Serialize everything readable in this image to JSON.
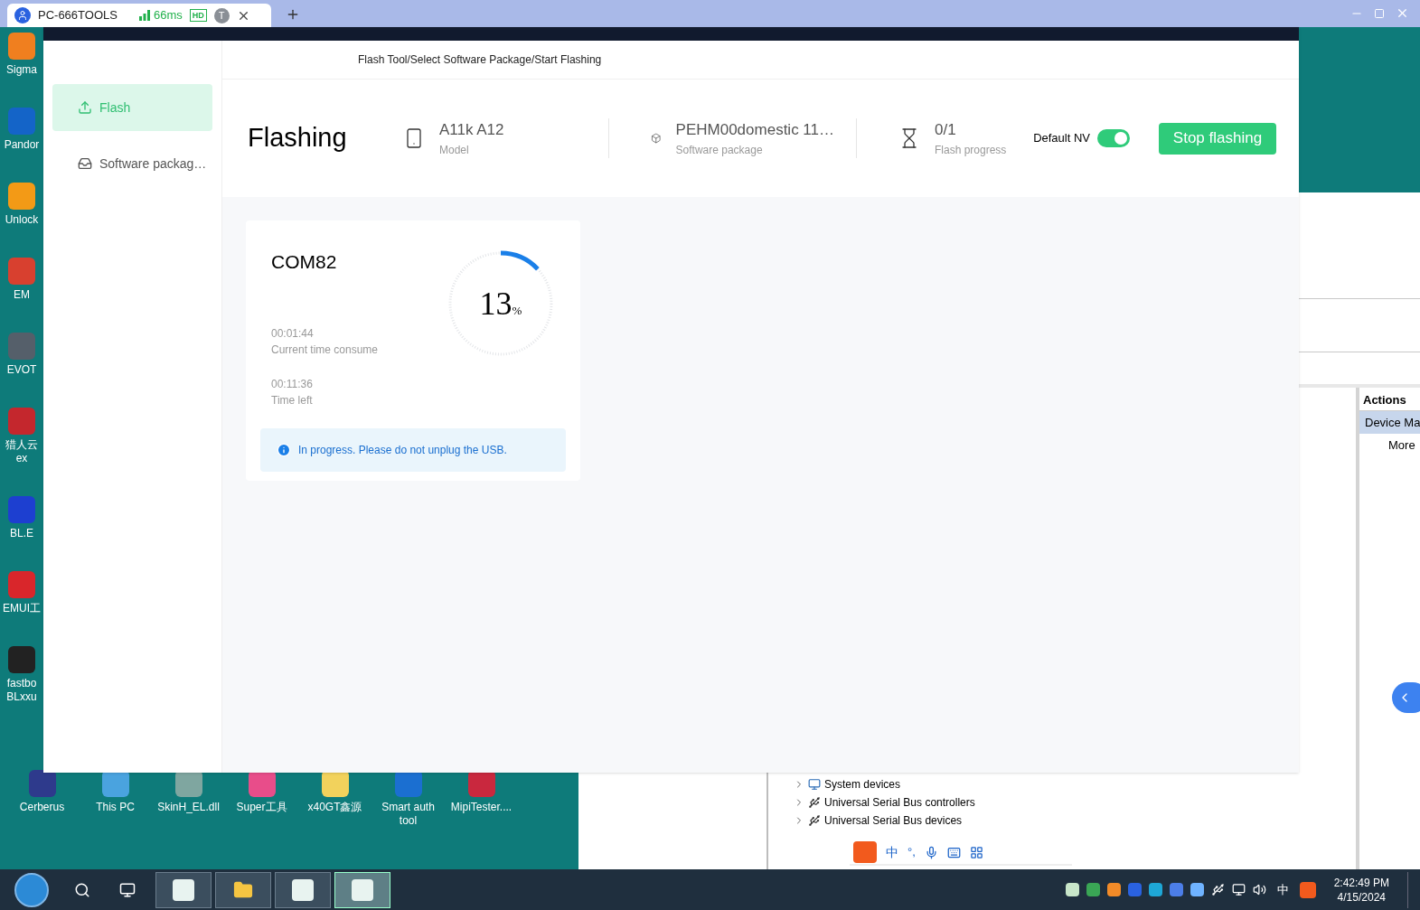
{
  "remote_tab": {
    "title": "PC-666TOOLS",
    "latency": "66ms",
    "quality": "HD",
    "avatar_letter": "T"
  },
  "desktop_icons_left": [
    {
      "lines": [
        "Sigma"
      ]
    },
    {
      "lines": [
        "Pandor"
      ]
    },
    {
      "lines": [
        "Unlock"
      ]
    },
    {
      "lines": [
        "EM"
      ]
    },
    {
      "lines": [
        "EVOT"
      ]
    },
    {
      "lines": [
        "猎人云",
        "ex"
      ]
    },
    {
      "lines": [
        "BL.E"
      ]
    },
    {
      "lines": [
        "EMUI工"
      ]
    },
    {
      "lines": [
        "fastbo",
        "BLxxu"
      ]
    }
  ],
  "desktop_icons_bottom": [
    {
      "lines": [
        "Cerberus"
      ]
    },
    {
      "lines": [
        "This PC"
      ]
    },
    {
      "lines": [
        "SkinH_EL.dll"
      ]
    },
    {
      "lines": [
        "Super工具"
      ]
    },
    {
      "lines": [
        "x40GT鑫源"
      ]
    },
    {
      "lines": [
        "Smart auth",
        "tool"
      ]
    },
    {
      "lines": [
        "MipiTester...."
      ]
    }
  ],
  "flash_tool": {
    "breadcrumb": "Flash Tool/Select Software Package/Start Flashing",
    "sidebar": [
      {
        "kind": "flash",
        "label": "Flash",
        "selected": true
      },
      {
        "kind": "package",
        "label": "Software packag…",
        "selected": false
      }
    ],
    "title": "Flashing",
    "info": [
      {
        "kind": "model",
        "value": "A11k A12",
        "label": "Model"
      },
      {
        "kind": "package",
        "value": "PEHM00domestic 11…",
        "label": "Software package"
      },
      {
        "kind": "progress",
        "value": "0/1",
        "label": "Flash progress"
      }
    ],
    "default_nv": {
      "label": "Default NV",
      "on": true
    },
    "stop_button": "Stop flashing",
    "port_card": {
      "port": "COM82",
      "percent": "13",
      "percent_sign": "%",
      "level": 0.13,
      "stats": [
        {
          "value": "00:01:44",
          "label": "Current time consume"
        },
        {
          "value": "00:11:36",
          "label": "Time left"
        }
      ],
      "notice": "In progress. Please do not unplug the USB."
    }
  },
  "device_manager": {
    "actions_header": "Actions",
    "actions": [
      {
        "label": "Device Ma",
        "selected": true
      },
      {
        "label": "More",
        "selected": false
      }
    ],
    "tree": [
      {
        "kind": "system",
        "label": "System devices",
        "expanded": false
      },
      {
        "kind": "usb",
        "label": "Universal Serial Bus controllers",
        "expanded": false
      },
      {
        "kind": "usb",
        "label": "Universal Serial Bus devices",
        "expanded": false
      }
    ]
  },
  "ime_bar": {
    "mode": "中",
    "punctuation": "°,"
  },
  "taskbar": {
    "apps": [
      {
        "selected": false
      },
      {
        "selected": false
      },
      {
        "selected": false
      },
      {
        "selected": true
      }
    ],
    "language": "中",
    "time": "2:42:49 PM",
    "date": "4/15/2024"
  }
}
